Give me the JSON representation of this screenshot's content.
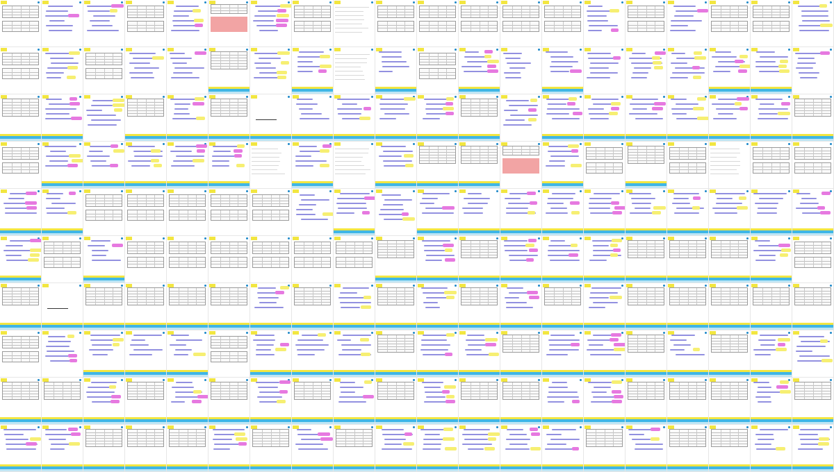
{
  "window": {
    "description_kind": "thumbnail-grid",
    "columns": 20,
    "rows": 10
  },
  "colors": {
    "page": "#ffffff",
    "yellow_tag": "#f2e640",
    "blue_band": "#3fb6e6",
    "light_blue_band": "#bfe6f5",
    "handwriting": "#6e6bd6",
    "pink_highlight": "#f19a9a",
    "yellow_highlight": "#f6ef72",
    "magenta_highlight": "#e679e0"
  },
  "thumbnails": {
    "kinds": [
      "table-page",
      "handwritten-notes",
      "handwritten-notes-with-band",
      "table-with-band",
      "blank-with-formula",
      "pink-table",
      "text-page"
    ],
    "layout": [
      [
        0,
        1,
        1,
        0,
        1,
        5,
        1,
        0,
        6,
        0,
        0,
        0,
        0,
        0,
        1,
        0,
        1,
        0,
        0,
        1
      ],
      [
        0,
        1,
        0,
        1,
        1,
        3,
        1,
        2,
        6,
        2,
        0,
        2,
        1,
        2,
        1,
        1,
        1,
        2,
        2,
        1
      ],
      [
        3,
        2,
        1,
        3,
        2,
        3,
        4,
        2,
        2,
        2,
        2,
        3,
        1,
        2,
        2,
        2,
        2,
        2,
        2,
        3
      ],
      [
        0,
        2,
        2,
        2,
        2,
        2,
        6,
        2,
        6,
        2,
        3,
        3,
        5,
        2,
        0,
        3,
        0,
        6,
        0,
        0
      ],
      [
        2,
        2,
        0,
        0,
        0,
        0,
        0,
        1,
        2,
        1,
        2,
        2,
        2,
        2,
        2,
        2,
        2,
        2,
        2,
        2
      ],
      [
        2,
        0,
        2,
        0,
        0,
        0,
        0,
        0,
        0,
        3,
        2,
        3,
        2,
        2,
        2,
        3,
        3,
        3,
        2,
        0
      ],
      [
        3,
        4,
        3,
        3,
        3,
        3,
        2,
        3,
        2,
        3,
        2,
        3,
        2,
        3,
        2,
        3,
        3,
        3,
        3,
        3
      ],
      [
        0,
        1,
        2,
        2,
        2,
        0,
        2,
        2,
        2,
        3,
        2,
        2,
        3,
        2,
        2,
        3,
        2,
        3,
        2,
        1
      ],
      [
        3,
        3,
        2,
        3,
        2,
        3,
        2,
        3,
        2,
        3,
        2,
        3,
        3,
        2,
        2,
        3,
        3,
        3,
        2,
        3
      ],
      [
        2,
        2,
        3,
        3,
        3,
        2,
        3,
        2,
        3,
        2,
        2,
        2,
        2,
        2,
        3,
        2,
        3,
        3,
        2,
        2
      ]
    ]
  }
}
